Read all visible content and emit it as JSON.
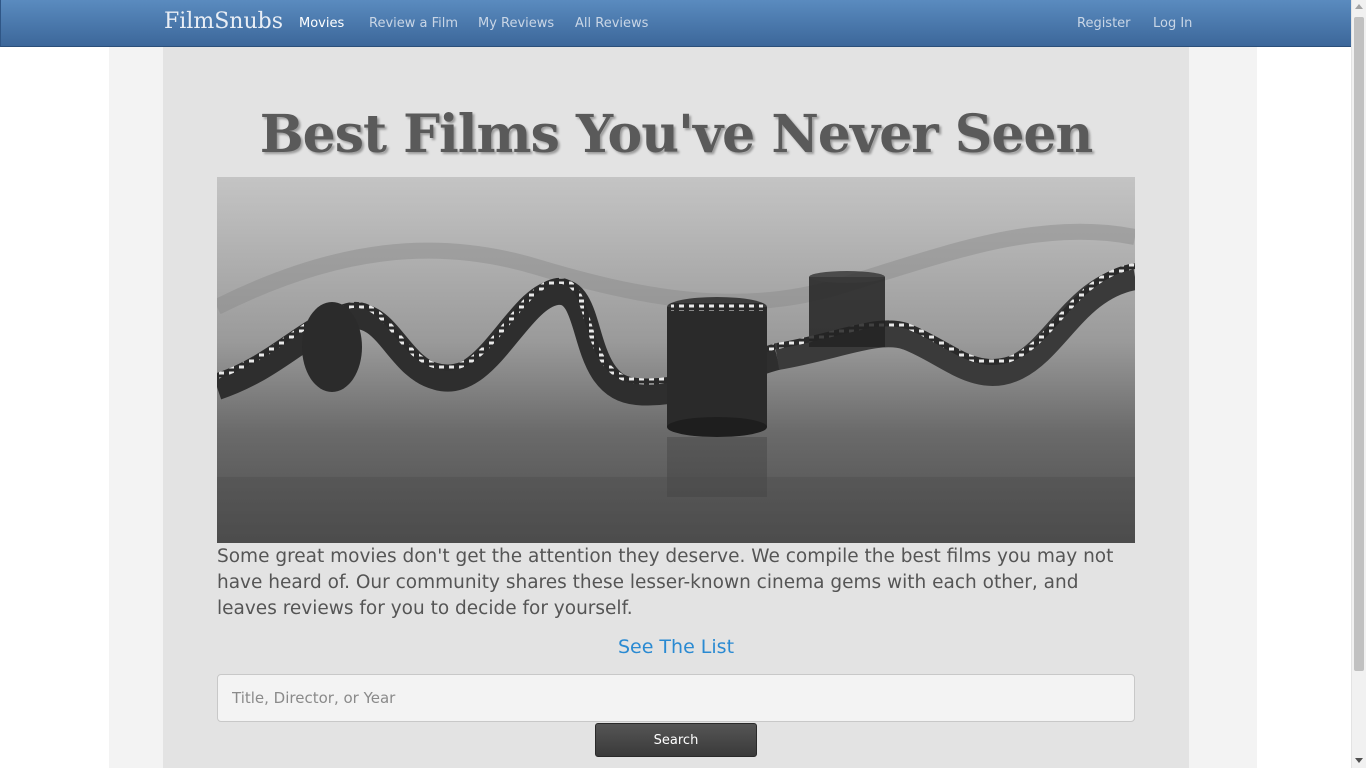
{
  "nav": {
    "brand": "FilmSnubs",
    "links": {
      "movies": "Movies",
      "review": "Review a Film",
      "my_reviews": "My Reviews",
      "all_reviews": "All Reviews"
    },
    "auth": {
      "register": "Register",
      "login": "Log In"
    },
    "active": "Movies"
  },
  "main": {
    "title": "Best Films You've Never Seen",
    "intro": "Some great movies don't get the attention they deserve. We compile the best films you may not have heard of. Our community shares these lesser-known cinema gems with each other, and leaves reviews for you to decide for yourself.",
    "see_list": "See The List",
    "search": {
      "placeholder": "Title, Director, or Year",
      "value": "",
      "button": "Search"
    }
  },
  "colors": {
    "navbar": "#4a78ad",
    "link": "#2a8ad2",
    "button": "#444444"
  }
}
